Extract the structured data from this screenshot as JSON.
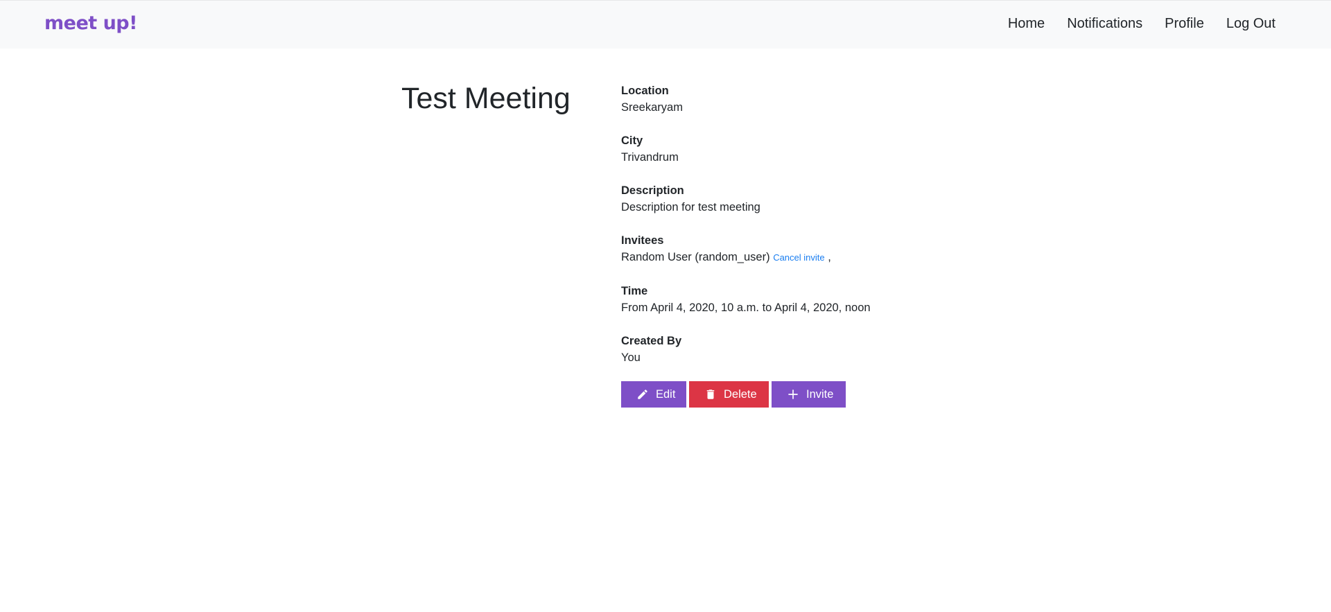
{
  "navbar": {
    "brand": "meet up!",
    "links": [
      {
        "label": "Home"
      },
      {
        "label": "Notifications"
      },
      {
        "label": "Profile"
      },
      {
        "label": "Log Out"
      }
    ]
  },
  "meeting": {
    "title": "Test Meeting",
    "fields": {
      "location": {
        "label": "Location",
        "value": "Sreekaryam"
      },
      "city": {
        "label": "City",
        "value": "Trivandrum"
      },
      "description": {
        "label": "Description",
        "value": "Description for test meeting"
      },
      "invitees": {
        "label": "Invitees",
        "invitee": "Random User (random_user)",
        "cancel_label": "Cancel invite",
        "separator": ","
      },
      "time": {
        "label": "Time",
        "value": "From April 4, 2020, 10 a.m. to April 4, 2020, noon"
      },
      "created_by": {
        "label": "Created By",
        "value": "You"
      }
    }
  },
  "actions": {
    "edit": {
      "label": "Edit",
      "icon": "pencil-icon",
      "color": "#7e4fc7"
    },
    "delete": {
      "label": "Delete",
      "icon": "trash-icon",
      "color": "#dc3545"
    },
    "invite": {
      "label": "Invite",
      "icon": "plus-icon",
      "color": "#7e4fc7"
    }
  },
  "colors": {
    "brand": "#7e4fc7",
    "navbar_bg": "#f8f9fa",
    "link": "#1a7ef0"
  }
}
